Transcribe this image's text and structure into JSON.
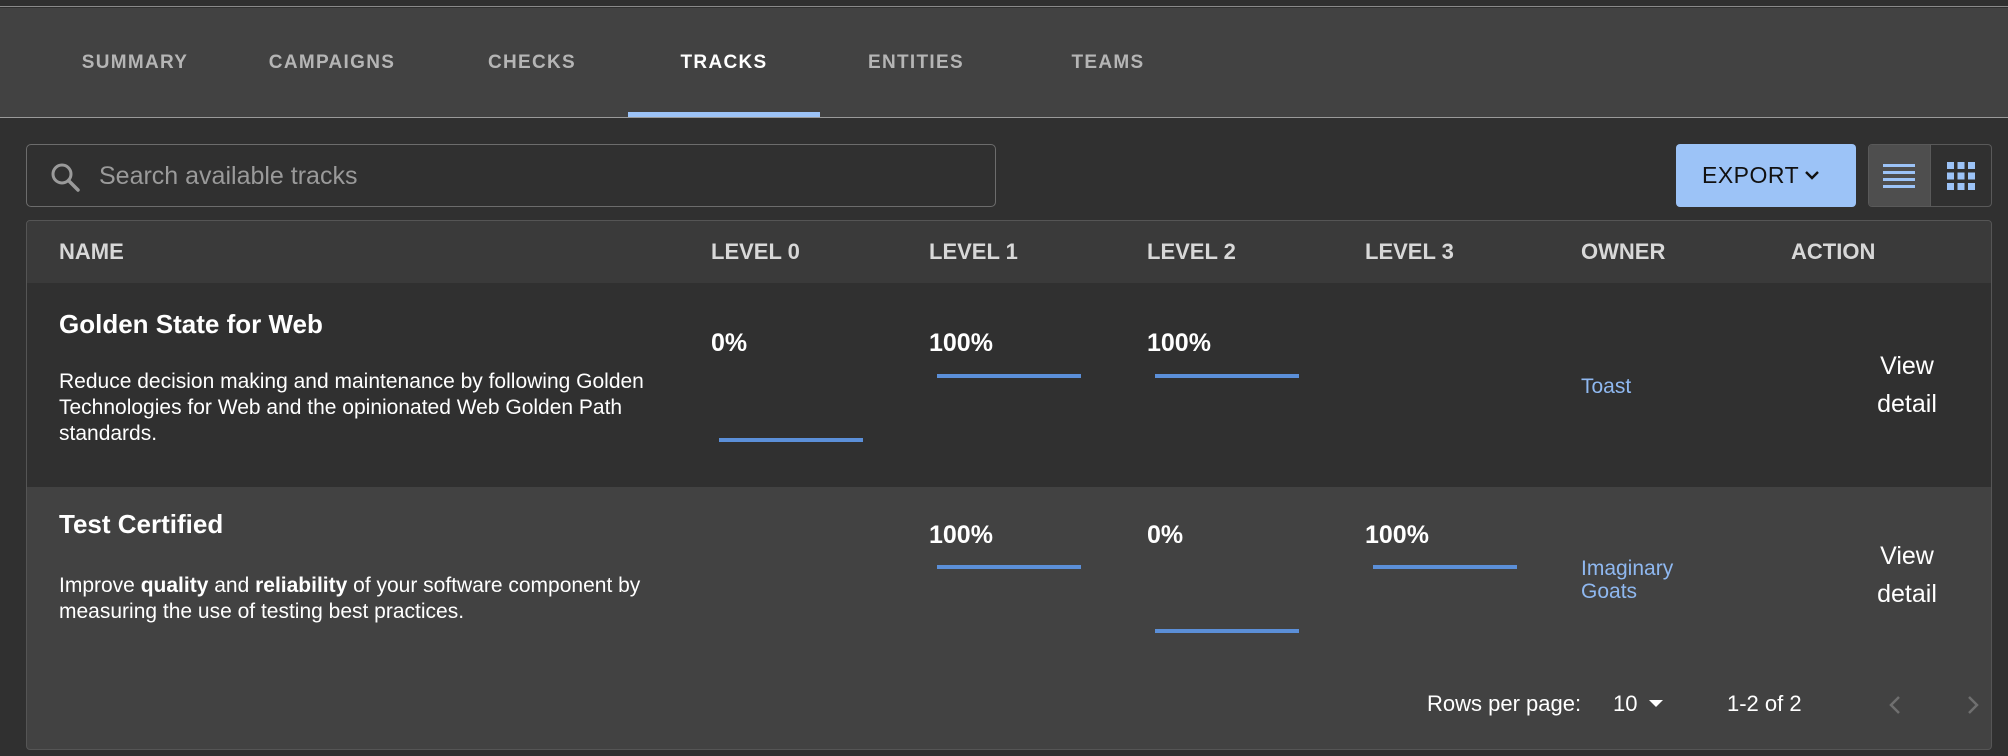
{
  "tabs": [
    {
      "label": "SUMMARY"
    },
    {
      "label": "CAMPAIGNS"
    },
    {
      "label": "CHECKS"
    },
    {
      "label": "TRACKS"
    },
    {
      "label": "ENTITIES"
    },
    {
      "label": "TEAMS"
    }
  ],
  "active_tab": "TRACKS",
  "search": {
    "placeholder": "Search available tracks",
    "value": ""
  },
  "toolbar": {
    "export_label": "EXPORT",
    "view_mode": "list"
  },
  "table": {
    "headers": {
      "name": "NAME",
      "level0": "LEVEL 0",
      "level1": "LEVEL 1",
      "level2": "LEVEL 2",
      "level3": "LEVEL 3",
      "owner": "OWNER",
      "action": "ACTION"
    },
    "rows": [
      {
        "name": "Golden State for Web",
        "description": "Reduce decision making and maintenance by following Golden Technologies for Web and the opinionated Web Golden Path standards.",
        "level0": "0%",
        "level1": "100%",
        "level2": "100%",
        "level3": "",
        "owner": "Toast",
        "action": "View detail"
      },
      {
        "name": "Test Certified",
        "description_parts": [
          {
            "text": "Improve ",
            "bold": false
          },
          {
            "text": "quality",
            "bold": true
          },
          {
            "text": " and ",
            "bold": false
          },
          {
            "text": "reliability",
            "bold": true
          },
          {
            "text": " of your software component by measuring the use of testing best practices.",
            "bold": false
          }
        ],
        "level0": "",
        "level1": "100%",
        "level2": "0%",
        "level3": "100%",
        "owner": "Imaginary Goats",
        "action": "View detail"
      }
    ]
  },
  "pagination": {
    "rows_per_page_label": "Rows per page:",
    "rows_per_page": "10",
    "range": "1-2 of 2"
  },
  "colors": {
    "accent": "#9cc3f7",
    "bar": "#5b8fd8",
    "link": "#8fb8f0",
    "background": "#303030",
    "surface": "#424242"
  }
}
